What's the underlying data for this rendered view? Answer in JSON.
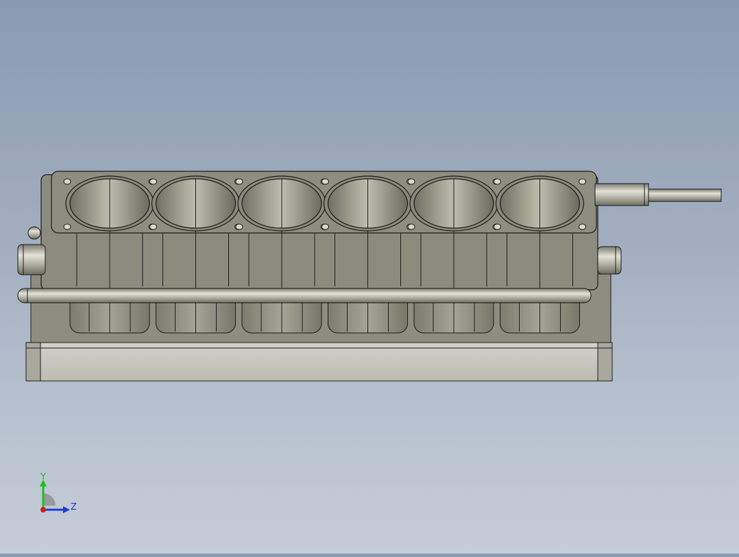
{
  "viewport": {
    "background_top": "#8a9ab0",
    "background_bottom": "#c4ccd7"
  },
  "model": {
    "cylinder_count": 6,
    "body_color": "#8c8c7e",
    "base_color": "#c6c5bc",
    "edge_color": "#1a1a1a"
  },
  "triad": {
    "y_label": "Y",
    "z_label": "Z",
    "y_color": "#19c119",
    "z_color": "#1a3cd6",
    "x_color": "#d61a1a"
  }
}
